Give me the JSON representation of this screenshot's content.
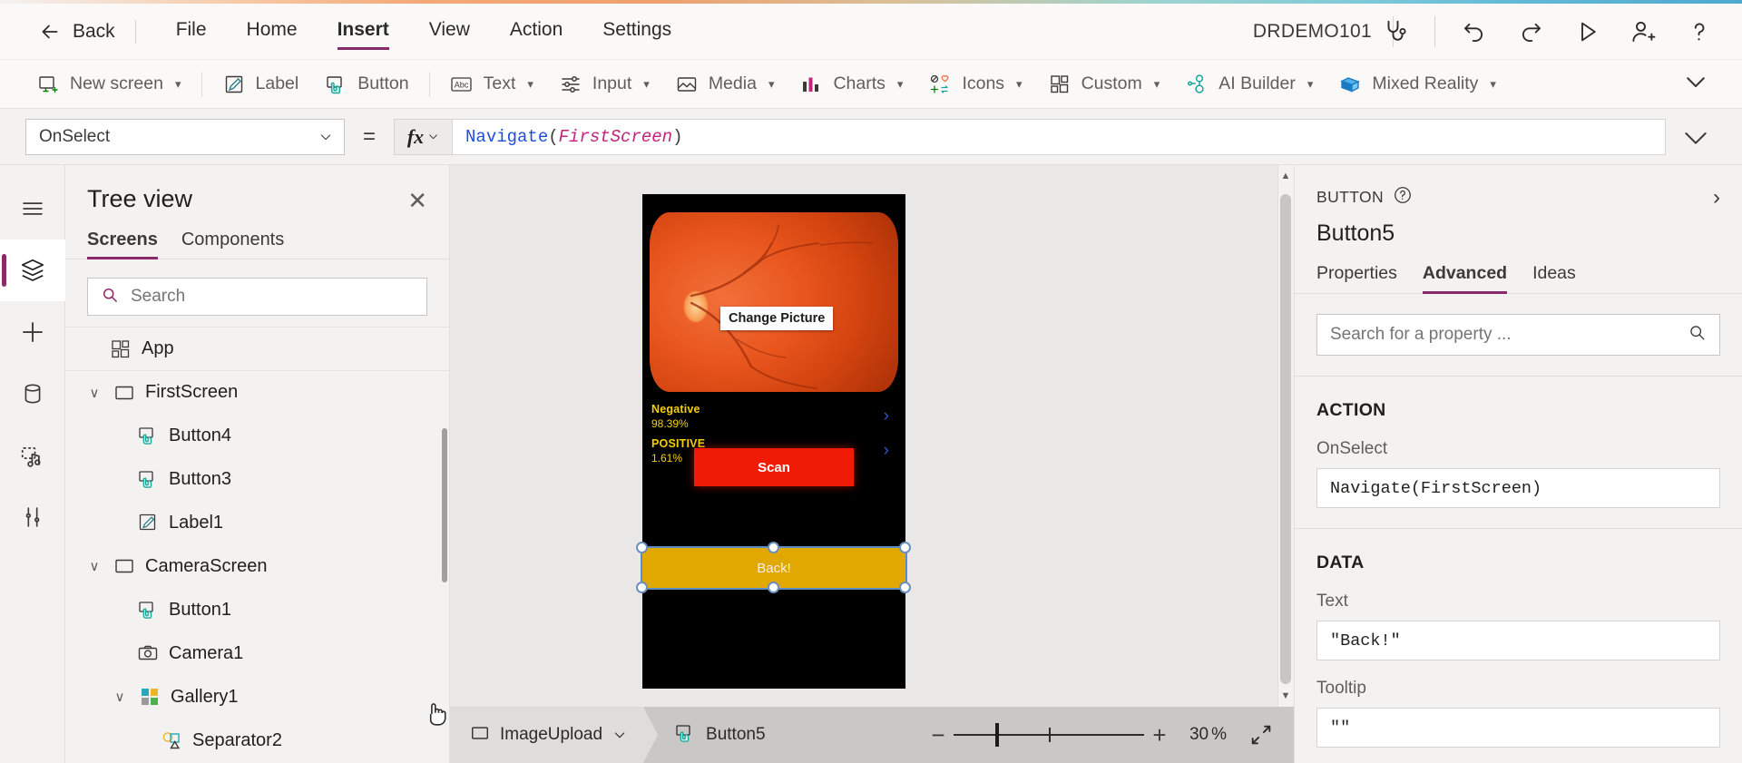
{
  "menubar": {
    "back_label": "Back",
    "items": [
      {
        "label": "File"
      },
      {
        "label": "Home"
      },
      {
        "label": "Insert"
      },
      {
        "label": "View"
      },
      {
        "label": "Action"
      },
      {
        "label": "Settings"
      }
    ],
    "active_item": "Insert",
    "app_name": "DRDEMO101",
    "icons": [
      "stethoscope-icon",
      "undo-icon",
      "redo-icon",
      "play-icon",
      "share-icon",
      "help-icon"
    ]
  },
  "ribbon": {
    "items": [
      {
        "label": "New screen",
        "icon": "new-screen-icon",
        "caret": true
      },
      {
        "label": "Label",
        "icon": "label-icon",
        "caret": false
      },
      {
        "label": "Button",
        "icon": "button-icon",
        "caret": false
      },
      {
        "label": "Text",
        "icon": "text-icon",
        "caret": true
      },
      {
        "label": "Input",
        "icon": "input-icon",
        "caret": true
      },
      {
        "label": "Media",
        "icon": "media-icon",
        "caret": true
      },
      {
        "label": "Charts",
        "icon": "charts-icon",
        "caret": true
      },
      {
        "label": "Icons",
        "icon": "icons-icon",
        "caret": true
      },
      {
        "label": "Custom",
        "icon": "custom-icon",
        "caret": true
      },
      {
        "label": "AI Builder",
        "icon": "ai-builder-icon",
        "caret": true
      },
      {
        "label": "Mixed Reality",
        "icon": "mixed-reality-icon",
        "caret": true
      }
    ]
  },
  "formula_bar": {
    "property": "OnSelect",
    "equals": "=",
    "fx_label": "fx",
    "formula_fn": "Navigate",
    "formula_open": "(",
    "formula_arg": "FirstScreen",
    "formula_close": ")"
  },
  "rail": {
    "items": [
      {
        "name": "hamburger-icon"
      },
      {
        "name": "tree-view-icon",
        "selected": true
      },
      {
        "name": "insert-icon"
      },
      {
        "name": "data-icon"
      },
      {
        "name": "media-icon"
      },
      {
        "name": "advanced-tools-icon"
      }
    ]
  },
  "tree_view": {
    "title": "Tree view",
    "close_label": "✕",
    "tabs": [
      {
        "label": "Screens",
        "active": true
      },
      {
        "label": "Components",
        "active": false
      }
    ],
    "search_placeholder": "Search",
    "search_value": "",
    "nodes": [
      {
        "label": "App",
        "icon": "app-icon",
        "indent": 0,
        "chevron": "",
        "divider": true
      },
      {
        "label": "FirstScreen",
        "icon": "screen-icon",
        "indent": 0,
        "chevron": "∨",
        "divider": true
      },
      {
        "label": "Button4",
        "icon": "button-icon",
        "indent": 1,
        "chevron": ""
      },
      {
        "label": "Button3",
        "icon": "button-icon",
        "indent": 1,
        "chevron": ""
      },
      {
        "label": "Label1",
        "icon": "label-icon",
        "indent": 1,
        "chevron": ""
      },
      {
        "label": "CameraScreen",
        "icon": "screen-icon",
        "indent": 0,
        "chevron": "∨"
      },
      {
        "label": "Button1",
        "icon": "button-icon",
        "indent": 1,
        "chevron": ""
      },
      {
        "label": "Camera1",
        "icon": "camera-icon",
        "indent": 1,
        "chevron": ""
      },
      {
        "label": "Gallery1",
        "icon": "gallery-icon",
        "indent": 1,
        "chevron": "∨"
      },
      {
        "label": "Separator2",
        "icon": "shapes-icon",
        "indent": 2,
        "chevron": ""
      }
    ]
  },
  "canvas": {
    "change_picture_label": "Change Picture",
    "predictions": [
      {
        "name": "Negative",
        "value": "98.39%"
      },
      {
        "name": "POSITIVE",
        "value": "1.61%"
      }
    ],
    "scan_label": "Scan",
    "back_label": "Back!",
    "colors": {
      "scan_button": "#ef1b06",
      "back_button": "#e0a800",
      "prediction_text": "#f5d000",
      "screen_background": "#000000"
    }
  },
  "status_bar": {
    "screen_crumb": "ImageUpload",
    "control_crumb": "Button5",
    "zoom_minus": "−",
    "zoom_plus": "+",
    "zoom_value": "30",
    "zoom_unit": "%"
  },
  "properties_panel": {
    "kind": "BUTTON",
    "help_icon": "?",
    "expand_icon": "›",
    "control_name": "Button5",
    "tabs": [
      {
        "label": "Properties",
        "active": false
      },
      {
        "label": "Advanced",
        "active": true
      },
      {
        "label": "Ideas",
        "active": false
      }
    ],
    "search_placeholder": "Search for a property ...",
    "search_value": "",
    "sections": [
      {
        "title": "ACTION",
        "props": [
          {
            "label": "OnSelect",
            "value": "Navigate(FirstScreen)"
          }
        ]
      },
      {
        "title": "DATA",
        "props": [
          {
            "label": "Text",
            "value": "\"Back!\""
          },
          {
            "label": "Tooltip",
            "value": "\"\""
          }
        ]
      }
    ]
  }
}
